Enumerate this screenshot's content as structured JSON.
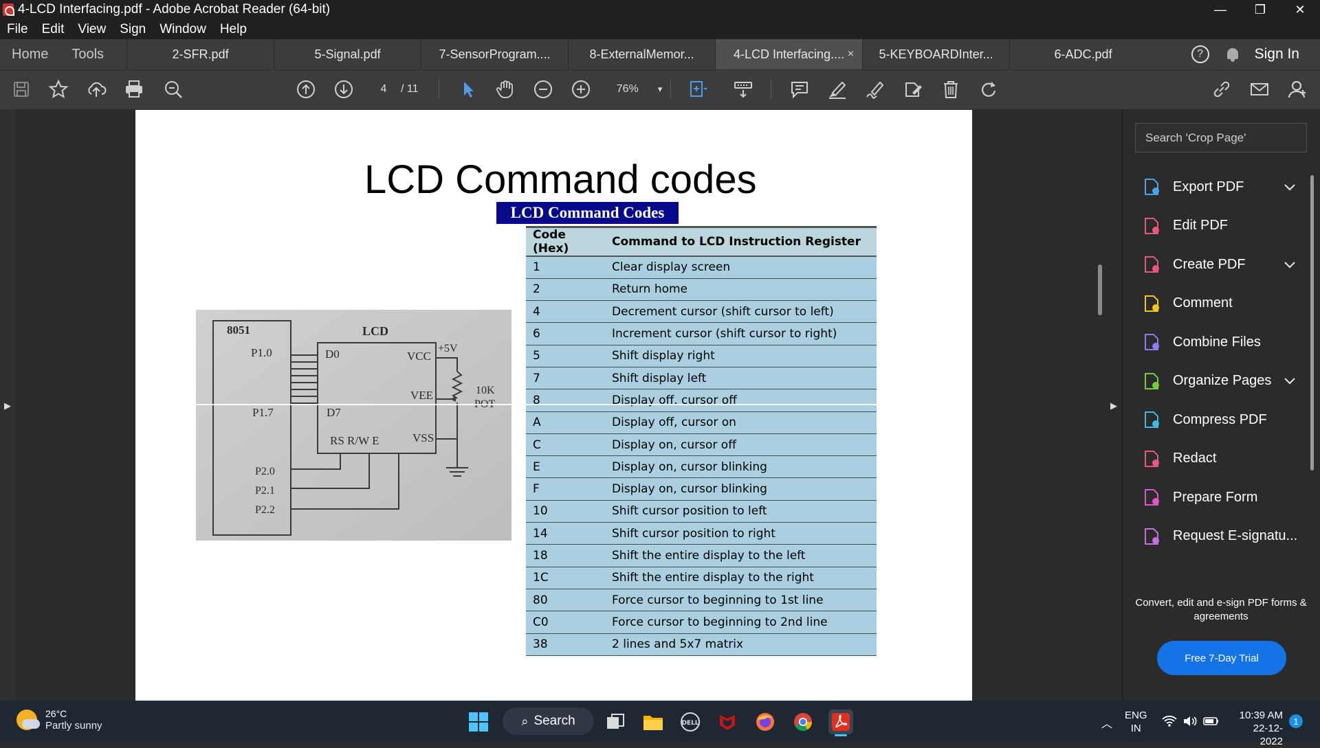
{
  "window": {
    "title": "4-LCD Interfacing.pdf - Adobe Acrobat Reader (64-bit)",
    "minimize": "—",
    "restore": "❐",
    "close": "✕"
  },
  "menu": [
    "File",
    "Edit",
    "View",
    "Sign",
    "Window",
    "Help"
  ],
  "nav": {
    "home": "Home",
    "tools": "Tools"
  },
  "tabs": [
    {
      "label": "2-SFR.pdf",
      "active": false
    },
    {
      "label": "5-Signal.pdf",
      "active": false
    },
    {
      "label": "7-SensorProgram....",
      "active": false
    },
    {
      "label": "8-ExternalMemor...",
      "active": false
    },
    {
      "label": "4-LCD Interfacing....",
      "active": true
    },
    {
      "label": "5-KEYBOARDInter...",
      "active": false
    },
    {
      "label": "6-ADC.pdf",
      "active": false
    }
  ],
  "tab_close": "×",
  "help_icon": "?",
  "sign_in": "Sign In",
  "toolbar": {
    "page_current": "4",
    "page_total": "/ 11",
    "zoom": "76%",
    "zoom_caret": "▾"
  },
  "document": {
    "slide_title": "LCD Command codes",
    "table_title": "LCD Command Codes",
    "table_headers": [
      "Code (Hex)",
      "Command to LCD Instruction Register"
    ],
    "rows": [
      [
        "1",
        "Clear display screen"
      ],
      [
        "2",
        "Return home"
      ],
      [
        "4",
        "Decrement cursor (shift cursor to left)"
      ],
      [
        "6",
        "Increment cursor (shift cursor to right)"
      ],
      [
        "5",
        "Shift display right"
      ],
      [
        "7",
        "Shift display left"
      ],
      [
        "8",
        "Display off, cursor off"
      ],
      [
        "A",
        "Display off, cursor on"
      ],
      [
        "C",
        "Display on, cursor off"
      ],
      [
        "E",
        "Display on, cursor blinking"
      ],
      [
        "F",
        "Display on, cursor blinking"
      ],
      [
        "10",
        "Shift cursor position to left"
      ],
      [
        "14",
        "Shift cursor position to right"
      ],
      [
        "18",
        "Shift the entire display to the left"
      ],
      [
        "1C",
        "Shift the entire display to the right"
      ],
      [
        "80",
        "Force cursor to beginning to 1st line"
      ],
      [
        "C0",
        "Force cursor to beginning to 2nd line"
      ],
      [
        "38",
        "2 lines and 5x7 matrix"
      ]
    ],
    "diagram": {
      "mcu": "8051",
      "lcd": "LCD",
      "p10": "P1.0",
      "p17": "P1.7",
      "p20": "P2.0",
      "p21": "P2.1",
      "p22": "P2.2",
      "d0": "D0",
      "d7": "D7",
      "vcc": "VCC",
      "vee": "VEE",
      "vss": "VSS",
      "rs_rw_e": "RS R/W E",
      "plus5v": "+5V",
      "pot1": "10K",
      "pot2": "POT"
    }
  },
  "right_panel": {
    "search_placeholder": "Search 'Crop Page'",
    "tools": [
      {
        "label": "Export PDF",
        "icon": "export-pdf-icon",
        "color": "#4aa3e8",
        "chevron": true
      },
      {
        "label": "Edit PDF",
        "icon": "edit-pdf-icon",
        "color": "#e9577d",
        "chevron": false
      },
      {
        "label": "Create PDF",
        "icon": "create-pdf-icon",
        "color": "#e9577d",
        "chevron": true
      },
      {
        "label": "Comment",
        "icon": "comment-icon",
        "color": "#f5c518",
        "chevron": false
      },
      {
        "label": "Combine Files",
        "icon": "combine-files-icon",
        "color": "#8f7cf0",
        "chevron": false
      },
      {
        "label": "Organize Pages",
        "icon": "organize-pages-icon",
        "color": "#6fcf3f",
        "chevron": true
      },
      {
        "label": "Compress PDF",
        "icon": "compress-pdf-icon",
        "color": "#3fb9e8",
        "chevron": false
      },
      {
        "label": "Redact",
        "icon": "redact-icon",
        "color": "#e9577d",
        "chevron": false
      },
      {
        "label": "Prepare Form",
        "icon": "prepare-form-icon",
        "color": "#e055c8",
        "chevron": false
      },
      {
        "label": "Request E-signatu...",
        "icon": "request-esign-icon",
        "color": "#c56fe0",
        "chevron": false
      }
    ],
    "promo": "Convert, edit and e-sign PDF forms & agreements",
    "trial_button": "Free 7-Day Trial"
  },
  "taskbar": {
    "temperature": "26°C",
    "weather": "Partly sunny",
    "search": "Search",
    "lang1": "ENG",
    "lang2": "IN",
    "time": "10:39 AM",
    "date": "22-12-2022",
    "notifications": "1"
  }
}
